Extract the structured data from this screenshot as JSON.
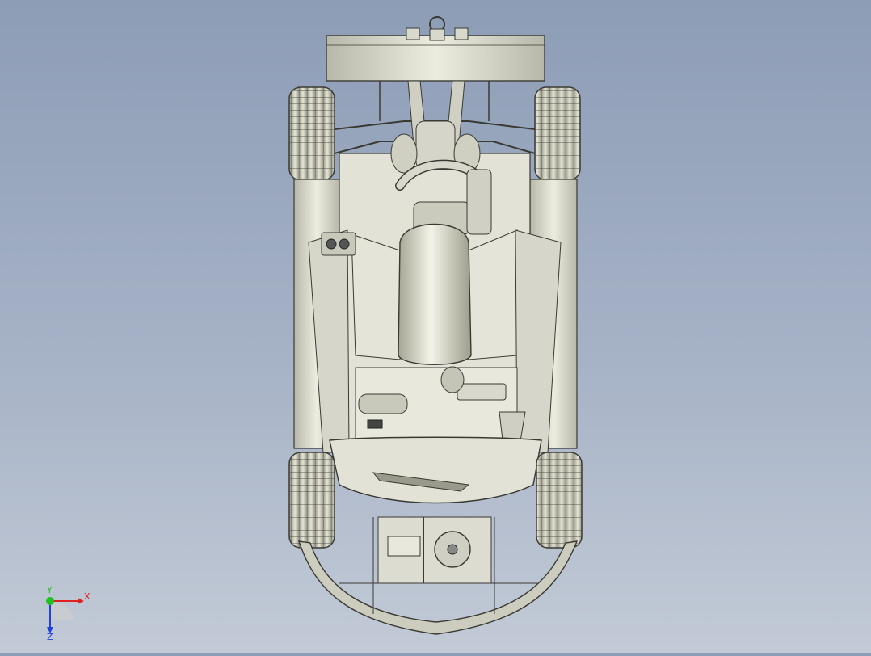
{
  "viewport": {
    "background_top": "#8d9db6",
    "background_bottom": "#c2cad6"
  },
  "model": {
    "body_color": "#dcdcd0",
    "line_color": "#3a3a34",
    "shadow_color": "#a8a898"
  },
  "triad": {
    "x_label": "X",
    "y_label": "Y",
    "z_label": "Z",
    "x_color": "#e02020",
    "y_color": "#20c020",
    "z_color": "#2040e0"
  }
}
